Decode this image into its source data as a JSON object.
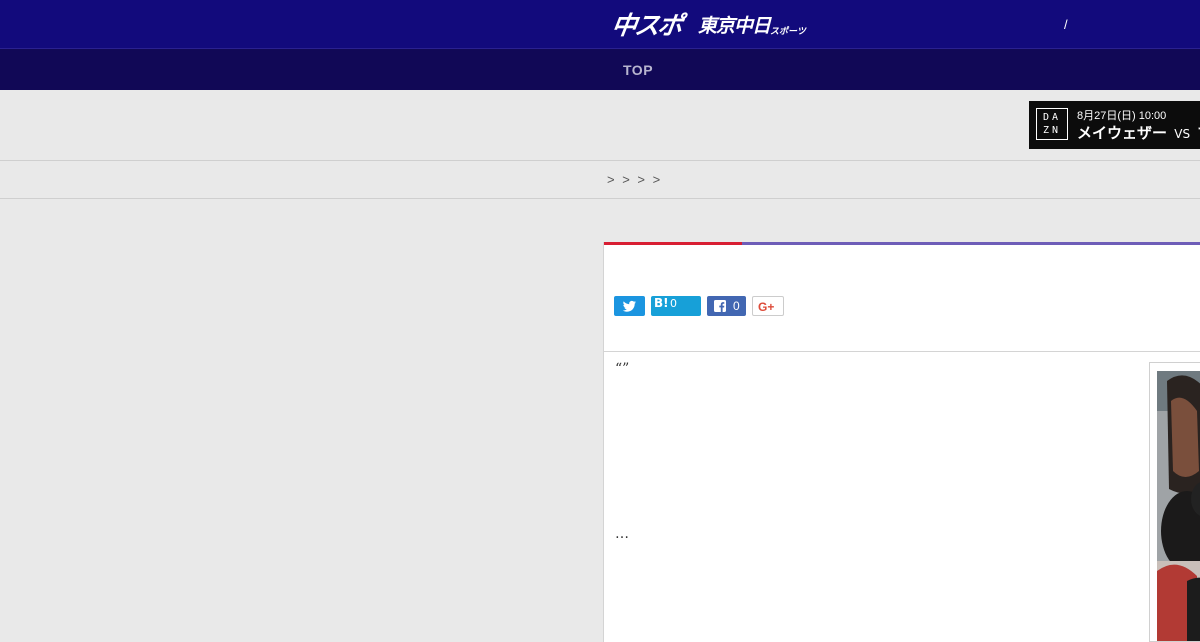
{
  "header": {
    "logo_main": "中スポ",
    "logo_sub": "東京中日",
    "logo_sub_small": "スポーツ",
    "slash": "/",
    "background": "#120a7c"
  },
  "nav": {
    "items": [
      {
        "label": "TOP"
      }
    ]
  },
  "ad": {
    "brand": "DAZN",
    "date": "8月27日(日) 10:00",
    "match_left": "メイウェザー",
    "vs": "VS",
    "match_right": "マ"
  },
  "breadcrumb": {
    "text": "> > > >"
  },
  "article": {
    "accent_color": "#d81e33",
    "line_color": "#6e5db8",
    "share": {
      "twitter_icon": "twitter-icon",
      "hatena_label": "B!",
      "hatena_count": "0",
      "facebook_count": "0",
      "gplus_label": "G+"
    },
    "lead_quote": "“”",
    "ellipsis": "…",
    "photo_icon": "boxer-photo"
  }
}
